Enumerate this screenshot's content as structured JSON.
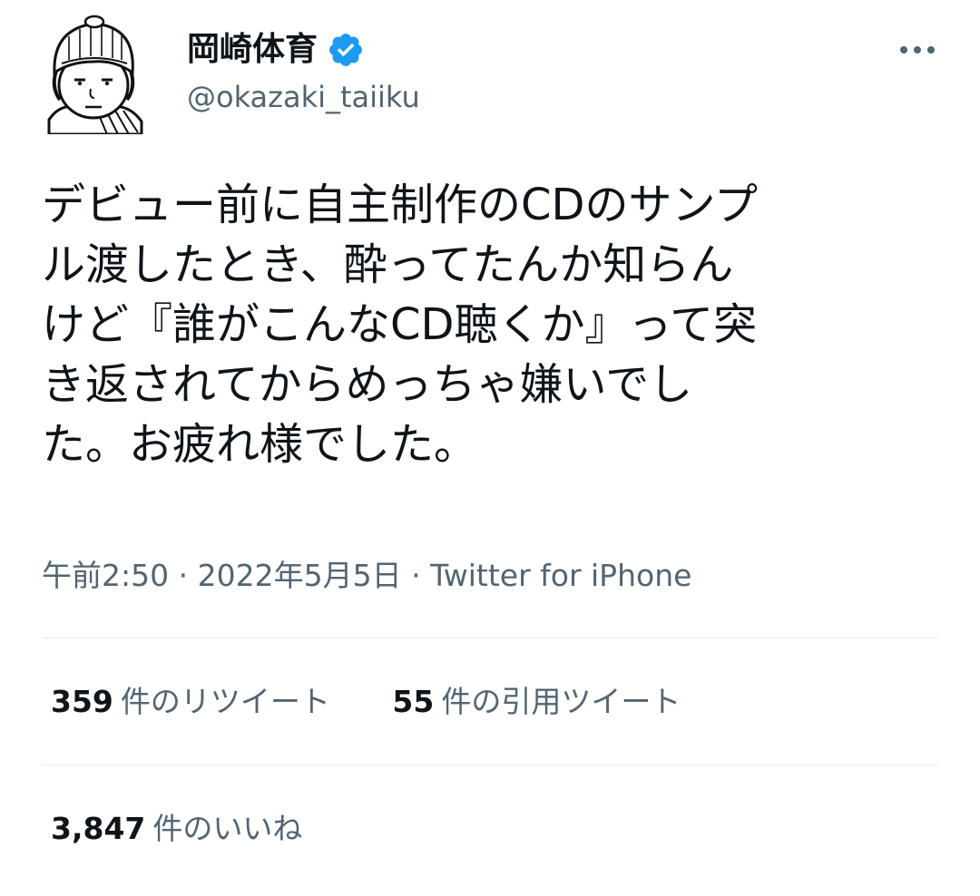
{
  "user": {
    "display_name": "岡崎体育",
    "handle": "@okazaki_taiiku",
    "avatar_icon": "cartoon-portrait-avatar",
    "verified_icon": "verified-badge-icon"
  },
  "tweet": {
    "lines": [
      "デビュー前に自主制作のCDのサンプ",
      "ル渡したとき、酔ってたんか知らん",
      "けど『誰がこんなCD聴くか』って突",
      "き返されてからめっちゃ嫌いでし",
      "た。お疲れ様でした。"
    ],
    "time": "午前2:50",
    "separator": "·",
    "date": "2022年5月5日",
    "source": "Twitter for iPhone"
  },
  "stats": {
    "retweets": {
      "count": "359",
      "label": "件のリツイート"
    },
    "quotes": {
      "count": "55",
      "label": "件の引用ツイート"
    },
    "likes": {
      "count": "3,847",
      "label": "件のいいね"
    }
  },
  "colors": {
    "text": "#0f1419",
    "secondary": "#536471",
    "verified": "#1d9bf0",
    "divider": "#e6ebef"
  }
}
